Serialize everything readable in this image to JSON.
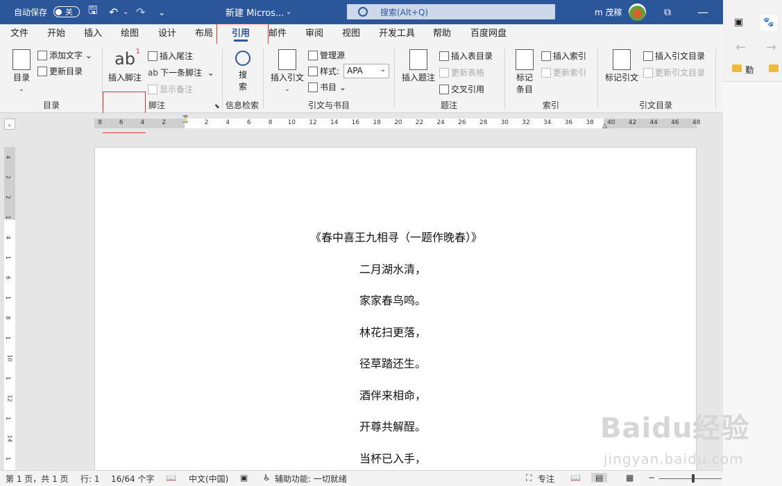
{
  "titlebar": {
    "autosave_label": "自动保存",
    "autosave_state": "关",
    "doc_title": "新建 Micros...",
    "search_placeholder": "搜索(Alt+Q)",
    "user_name": "m 茂稼"
  },
  "tabs": [
    "文件",
    "开始",
    "插入",
    "绘图",
    "设计",
    "布局",
    "引用",
    "邮件",
    "审阅",
    "视图",
    "开发工具",
    "帮助",
    "百度网盘"
  ],
  "active_tab": "引用",
  "ribbon": {
    "toc": {
      "big": "目录",
      "add_text": "添加文字",
      "update": "更新目录",
      "group": "目录"
    },
    "footnotes": {
      "big": "插入脚注",
      "endnote": "插入尾注",
      "next": "下一条脚注",
      "show": "显示备注",
      "group": "脚注"
    },
    "research": {
      "big": "搜\n索",
      "big_top": "搜",
      "big_bottom": "索",
      "group": "信息检索"
    },
    "citations": {
      "big": "插入引文",
      "manage": "管理源",
      "style_label": "样式:",
      "style_value": "APA",
      "biblio": "书目",
      "group": "引文与书目"
    },
    "captions": {
      "big": "插入题注",
      "table_figs": "插入表目录",
      "update_table": "更新表格",
      "cross_ref": "交叉引用",
      "group": "题注"
    },
    "index": {
      "big_top": "标记",
      "big_bottom": "条目",
      "insert": "插入索引",
      "update": "更新索引",
      "group": "索引"
    },
    "toa": {
      "big": "标记引文",
      "insert": "插入引文目录",
      "update": "更新引文目录",
      "group": "引文目录"
    }
  },
  "ruler_numbers": [
    "8",
    "6",
    "4",
    "2",
    "",
    "2",
    "4",
    "6",
    "8",
    "10",
    "12",
    "14",
    "16",
    "18",
    "20",
    "22",
    "24",
    "26",
    "28",
    "30",
    "32",
    "34",
    "36",
    "38",
    "40",
    "42",
    "44",
    "46",
    "48"
  ],
  "vruler_numbers": [
    "4",
    "2",
    "2",
    "1",
    "4",
    "1",
    "6",
    "1",
    "8",
    "1",
    "10",
    "1",
    "12",
    "1",
    "14",
    "1"
  ],
  "document": {
    "lines": [
      "《春中喜王九相寻（一题作晚春）》",
      "二月湖水清，",
      "家家春鸟鸣。",
      "林花扫更落，",
      "径草踏还生。",
      "酒伴来相命，",
      "开尊共解酲。",
      "当杯已入手，"
    ]
  },
  "status": {
    "page": "第 1 页，共 1 页",
    "line": "行: 1",
    "words": "16/64 个字",
    "lang": "中文(中国)",
    "accessibility": "辅助功能: 一切就绪",
    "focus": "专注"
  },
  "sidebar": {
    "folder1": "勤"
  },
  "watermark": {
    "main": "Baidu经验",
    "sub": "jingyan.baidu.com"
  },
  "colors": {
    "accent": "#2b579a",
    "highlight": "#d9343a"
  }
}
